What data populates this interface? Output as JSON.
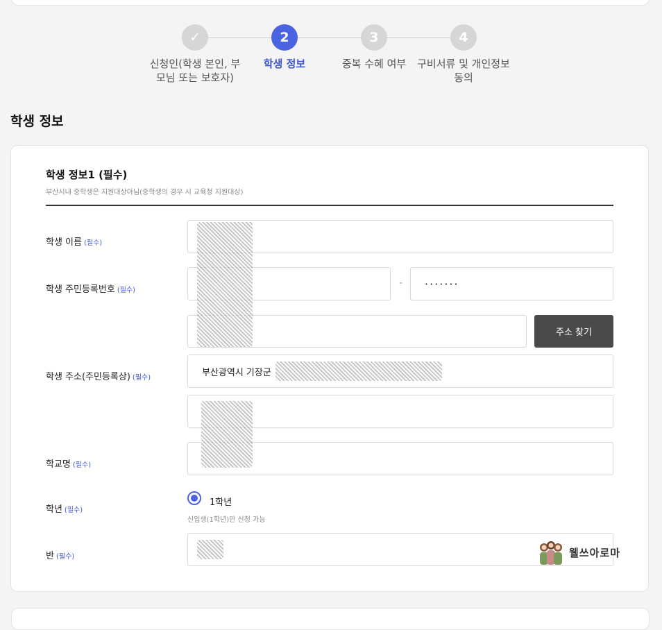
{
  "stepper": {
    "steps": [
      {
        "number": "✓",
        "label": "신청인(학생 본인, 부모님 또는 보호자)"
      },
      {
        "number": "2",
        "label": "학생 정보"
      },
      {
        "number": "3",
        "label": "중복 수혜 여부"
      },
      {
        "number": "4",
        "label": "구비서류 및 개인정보 동의"
      }
    ],
    "active_index": 1,
    "active_color": "#4a63e0"
  },
  "section_title": "학생 정보",
  "card": {
    "title": "학생 정보1 (필수)",
    "subtitle": "부산시내 중학생은 지원대상아님(중학생의 경우 시 교육청 지원대상)"
  },
  "form": {
    "required_tag": "(필수)",
    "name_label": "학생 이름",
    "rrn_label": "학생 주민등록번호",
    "rrn_separator": "-",
    "rrn_back_value": "·······",
    "address_label": "학생 주소(주민등록상)",
    "address_search_button": "주소 찾기",
    "address_main_value": "부산광역시 기장군",
    "school_label": "학교명",
    "grade_label": "학년",
    "grade_option": "1학년",
    "grade_note": "신입생(1학년)만 신청 가능",
    "class_label": "반"
  },
  "watermark": {
    "text": "웰쓰아로마",
    "icon": "three-women-icon"
  }
}
